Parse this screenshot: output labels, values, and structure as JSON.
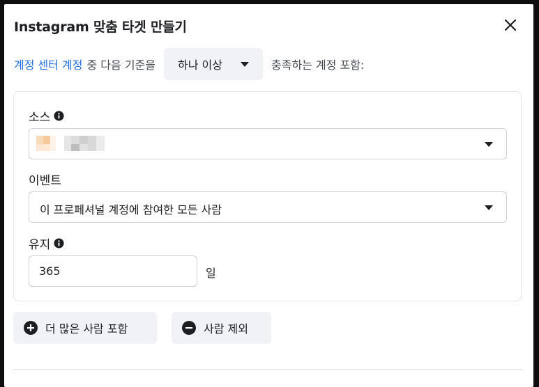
{
  "dialog": {
    "title": "Instagram 맞춤 타겟 만들기",
    "close_icon": "close-icon"
  },
  "criteria": {
    "link_text": "계정 센터 계정",
    "prefix_text": "중 다음 기준을",
    "match_select_value": "하나 이상",
    "suffix_text": "충족하는 계정 포함:"
  },
  "source": {
    "label": "소스",
    "info_icon": "info-icon",
    "value_redacted": true
  },
  "event": {
    "label": "이벤트",
    "value": "이 프로페셔널 계정에 참여한 모든 사람"
  },
  "retention": {
    "label": "유지",
    "info_icon": "info-icon",
    "value": "365",
    "unit": "일"
  },
  "actions": {
    "include_more_label": "더 많은 사람 포함",
    "include_icon": "plus-circle-icon",
    "exclude_label": "사람 제외",
    "exclude_icon": "minus-circle-icon"
  },
  "colors": {
    "link": "#216fdb",
    "button_bg": "#f0f2f5",
    "border": "#ccd0d5"
  }
}
